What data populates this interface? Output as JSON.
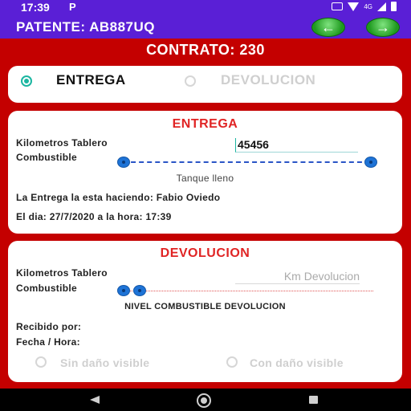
{
  "status_bar": {
    "time": "17:39",
    "notification": "P",
    "network": "4G"
  },
  "header": {
    "title": "PATENTE: AB887UQ"
  },
  "contract": {
    "label": "CONTRATO: 230"
  },
  "mode": {
    "options": [
      "ENTREGA",
      "DEVOLUCION"
    ],
    "selected": "ENTREGA"
  },
  "entrega": {
    "title": "ENTREGA",
    "km_label": "Kilometros Tablero",
    "km_value": "45456",
    "fuel_label": "Combustible",
    "fuel_level": 1.0,
    "fuel_caption": "Tanque lleno",
    "doing_by": "La Entrega la esta haciendo: Fabio Oviedo",
    "date_line": "El dia: 27/7/2020 a la hora: 17:39"
  },
  "devolucion": {
    "title": "DEVOLUCION",
    "km_label": "Kilometros Tablero",
    "km_placeholder": "Km Devolucion",
    "fuel_label": "Combustible",
    "fuel_level": 0.0,
    "fuel_caption": "NIVEL COMBUSTIBLE DEVOLUCION",
    "received_label": "Recibido por:",
    "datetime_label": "Fecha / Hora:",
    "damage_options": [
      "Sin daño visible",
      "Con daño visible"
    ]
  },
  "colors": {
    "accent": "#5a1fd6",
    "background": "#c40000",
    "title_red": "#e02424",
    "radio_on": "#1bb6a1"
  },
  "icons": {
    "back": "arrow-left-icon",
    "forward": "arrow-right-icon"
  }
}
